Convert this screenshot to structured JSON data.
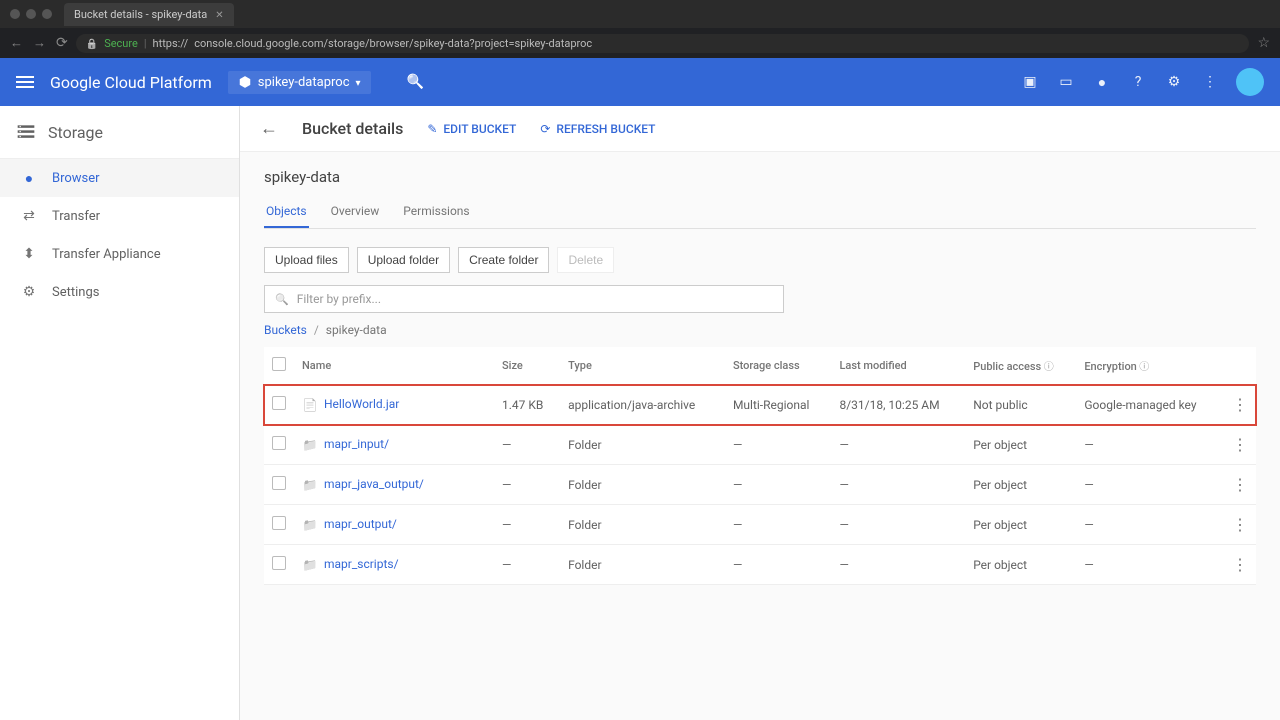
{
  "browser": {
    "tab_title": "Bucket details - spikey-data",
    "secure_label": "Secure",
    "url_prefix": "https://",
    "url": "console.cloud.google.com/storage/browser/spikey-data?project=spikey-dataproc"
  },
  "header": {
    "title": "Google Cloud Platform",
    "project": "spikey-dataproc"
  },
  "sidebar": {
    "section_title": "Storage",
    "items": [
      {
        "label": "Browser",
        "icon": "browser",
        "active": true
      },
      {
        "label": "Transfer",
        "icon": "transfer",
        "active": false
      },
      {
        "label": "Transfer Appliance",
        "icon": "appliance",
        "active": false
      },
      {
        "label": "Settings",
        "icon": "settings",
        "active": false
      }
    ]
  },
  "toolbar": {
    "page_title": "Bucket details",
    "edit_label": "EDIT BUCKET",
    "refresh_label": "REFRESH BUCKET"
  },
  "bucket": {
    "name": "spikey-data"
  },
  "tabs": [
    {
      "label": "Objects",
      "active": true
    },
    {
      "label": "Overview",
      "active": false
    },
    {
      "label": "Permissions",
      "active": false
    }
  ],
  "buttons": {
    "upload_files": "Upload files",
    "upload_folder": "Upload folder",
    "create_folder": "Create folder",
    "delete": "Delete"
  },
  "filter": {
    "placeholder": "Filter by prefix..."
  },
  "breadcrumb": {
    "root": "Buckets",
    "current": "spikey-data"
  },
  "columns": {
    "name": "Name",
    "size": "Size",
    "type": "Type",
    "storage_class": "Storage class",
    "last_modified": "Last modified",
    "public_access": "Public access",
    "encryption": "Encryption"
  },
  "rows": [
    {
      "name": "HelloWorld.jar",
      "icon": "file",
      "size": "1.47 KB",
      "type": "application/java-archive",
      "storage_class": "Multi-Regional",
      "last_modified": "8/31/18, 10:25 AM",
      "public_access": "Not public",
      "encryption": "Google-managed key",
      "highlighted": true
    },
    {
      "name": "mapr_input/",
      "icon": "folder",
      "size": "—",
      "type": "Folder",
      "storage_class": "—",
      "last_modified": "—",
      "public_access": "Per object",
      "encryption": "—",
      "highlighted": false
    },
    {
      "name": "mapr_java_output/",
      "icon": "folder",
      "size": "—",
      "type": "Folder",
      "storage_class": "—",
      "last_modified": "—",
      "public_access": "Per object",
      "encryption": "—",
      "highlighted": false
    },
    {
      "name": "mapr_output/",
      "icon": "folder",
      "size": "—",
      "type": "Folder",
      "storage_class": "—",
      "last_modified": "—",
      "public_access": "Per object",
      "encryption": "—",
      "highlighted": false
    },
    {
      "name": "mapr_scripts/",
      "icon": "folder",
      "size": "—",
      "type": "Folder",
      "storage_class": "—",
      "last_modified": "—",
      "public_access": "Per object",
      "encryption": "—",
      "highlighted": false
    }
  ]
}
